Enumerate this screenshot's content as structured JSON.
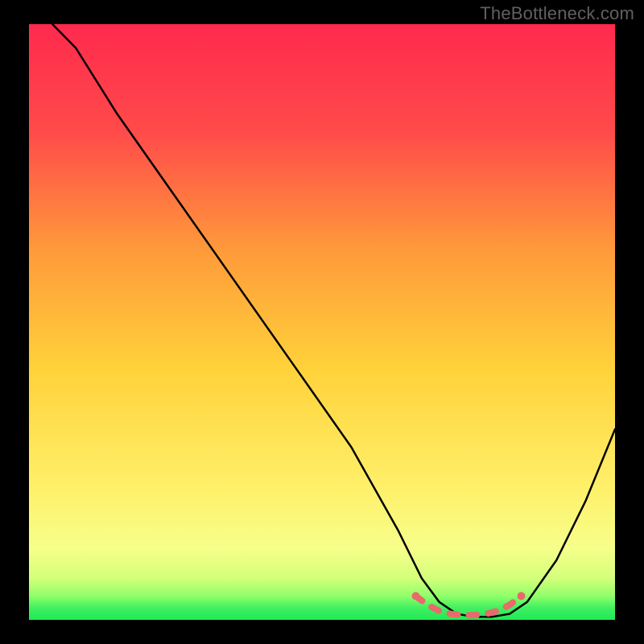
{
  "watermark": "TheBottleneck.com",
  "chart_data": {
    "type": "line",
    "title": "",
    "xlabel": "",
    "ylabel": "",
    "xlim": [
      0,
      100
    ],
    "ylim": [
      0,
      100
    ],
    "series": [
      {
        "name": "bottleneck-curve",
        "x": [
          4,
          8,
          15,
          25,
          35,
          45,
          55,
          63,
          67,
          70,
          73,
          76,
          79,
          82,
          85,
          90,
          95,
          100
        ],
        "values": [
          100,
          96,
          85,
          71,
          57,
          43,
          29,
          15,
          7,
          3,
          1,
          0.5,
          0.5,
          1,
          3,
          10,
          20,
          32
        ]
      },
      {
        "name": "optimal-range-marker",
        "x": [
          66,
          68,
          70,
          72,
          74,
          76,
          78,
          80,
          82,
          84
        ],
        "values": [
          4,
          2.5,
          1.5,
          1,
          0.8,
          0.8,
          1,
          1.5,
          2.5,
          4
        ]
      }
    ],
    "background_gradient": {
      "top": "#ff2a4d",
      "upper_mid": "#ff8a3d",
      "mid": "#ffd23d",
      "lower_mid": "#fff66b",
      "bottom_highlight": "#f6ff8a",
      "bottom": "#1eea55"
    },
    "marker_color": "#e96a6a",
    "curve_color": "#000000"
  }
}
